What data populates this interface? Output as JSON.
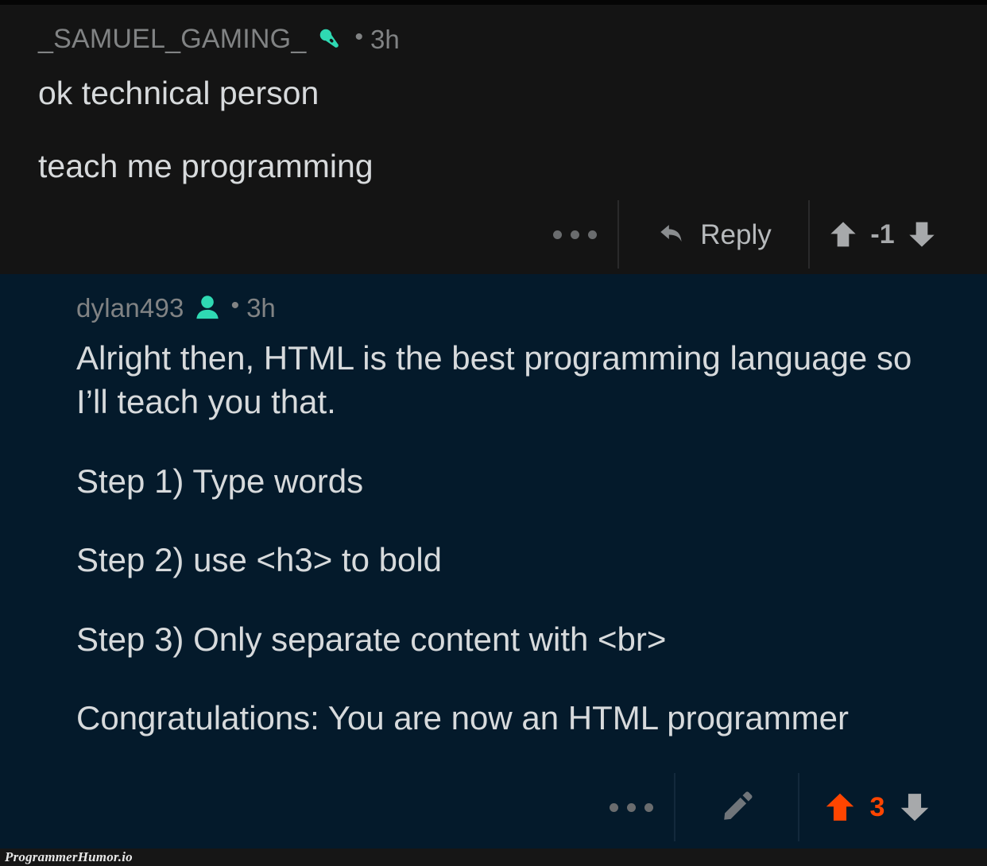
{
  "watermark": "ProgrammerHumor.io",
  "colors": {
    "comment_one_bg": "#141414",
    "comment_two_bg": "#041a2b",
    "username": "#818384",
    "body_text": "#d7dadc",
    "icon_accent_teal": "#2fd9b3",
    "upvote_orange": "#ff4500",
    "icon_gray": "#8a8d8f"
  },
  "comments": [
    {
      "username": "_SAMUEL_GAMING_",
      "badge_icon": "microphone-icon",
      "separator": "•",
      "timestamp": "3h",
      "paragraphs": [
        "ok technical person",
        "teach me programming"
      ],
      "actions": {
        "overflow_icon": "more-horizontal-icon",
        "reply_label": "Reply",
        "reply_icon": "reply-arrow-icon",
        "upvote_icon": "upvote-arrow-icon",
        "downvote_icon": "downvote-arrow-icon",
        "score": "-1",
        "vote_state": "none"
      }
    },
    {
      "username": "dylan493",
      "badge_icon": "user-person-icon",
      "separator": "•",
      "timestamp": "3h",
      "paragraphs": [
        "Alright then, HTML is the best programming language so I’ll teach you that.",
        "Step 1) Type words",
        "Step 2) use <h3> to bold",
        "Step 3) Only separate content with <br>",
        "Congratulations: You are now an HTML programmer"
      ],
      "actions": {
        "overflow_icon": "more-horizontal-icon",
        "edit_icon": "pencil-edit-icon",
        "upvote_icon": "upvote-arrow-icon",
        "downvote_icon": "downvote-arrow-icon",
        "score": "3",
        "vote_state": "upvoted"
      }
    }
  ]
}
